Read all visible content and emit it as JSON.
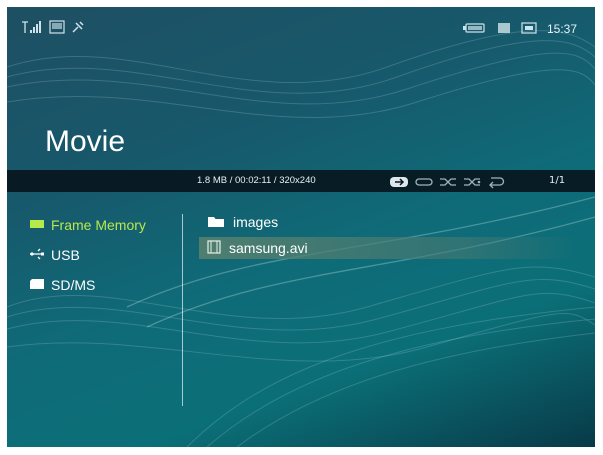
{
  "status": {
    "time": "15:37",
    "left_icons": [
      "signal-icon",
      "pc-icon",
      "connection-icon"
    ],
    "right_icons": [
      "battery-icon",
      "memory-card-icon",
      "usb-device-icon"
    ]
  },
  "page_title": "Movie",
  "info_bar": {
    "file_info": "1.8 MB / 00:02:11 / 320x240",
    "page_indicator": "1/1",
    "mode_icons": [
      "repeat-one-icon",
      "repeat-all-icon",
      "shuffle-icon",
      "shuffle-all-icon",
      "return-icon"
    ]
  },
  "sidebar": {
    "items": [
      {
        "label": "Frame Memory",
        "icon": "frame-memory-icon",
        "active": true,
        "icon_color": "#b7e94a"
      },
      {
        "label": "USB",
        "icon": "usb-icon",
        "active": false
      },
      {
        "label": "SD/MS",
        "icon": "sd-card-icon",
        "active": false
      }
    ]
  },
  "files": [
    {
      "name": "images",
      "type": "folder",
      "icon": "folder-icon",
      "selected": false
    },
    {
      "name": "samsung.avi",
      "type": "video",
      "icon": "film-icon",
      "selected": true
    }
  ],
  "colors": {
    "accent_green": "#b7e94a",
    "info_bar": "#08161e"
  }
}
